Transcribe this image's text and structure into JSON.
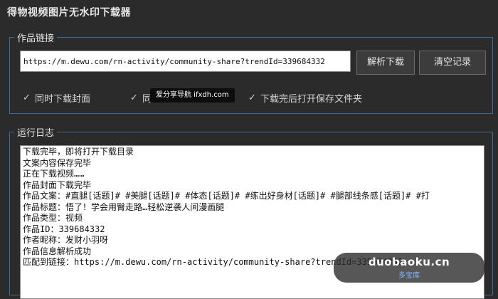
{
  "app": {
    "title": "得物视频图片无水印下载器"
  },
  "link_group": {
    "legend": "作品链接",
    "url_value": "https://m.dewu.com/rn-activity/community-share?trendId=339684332",
    "parse_button": "解析下载",
    "clear_button": "清空记录",
    "checkboxes": [
      {
        "label": "同时下载封面",
        "checked": true
      },
      {
        "label": "同",
        "checked": true
      },
      {
        "label": "下载完后打开保存文件夹",
        "checked": true
      }
    ]
  },
  "overlay": {
    "caption": "爱分享导航 ifxdh.com"
  },
  "log_group": {
    "legend": "运行日志",
    "lines": [
      "下载完毕，即将打开下载目录",
      "文案内容保存完毕",
      "正在下载视频……",
      "作品封面下载完毕",
      "作品文案：#直腿[话题]# #美腿[话题]# #体态[话题]# #练出好身材[话题]# #腿部线条感[话题]# #打",
      "作品标题：悟了！学会用臀走路…轻松逆袭人间漫画腿",
      "作品类型：视频",
      "作品ID：339684332",
      "作者昵称：发财小羽呀",
      "作品信息解析成功",
      "匹配到链接：https://m.dewu.com/rn-activity/community-share?trendId=339684332"
    ]
  },
  "watermark": {
    "main": "duobaoku.cn",
    "sub": "多宝库"
  }
}
